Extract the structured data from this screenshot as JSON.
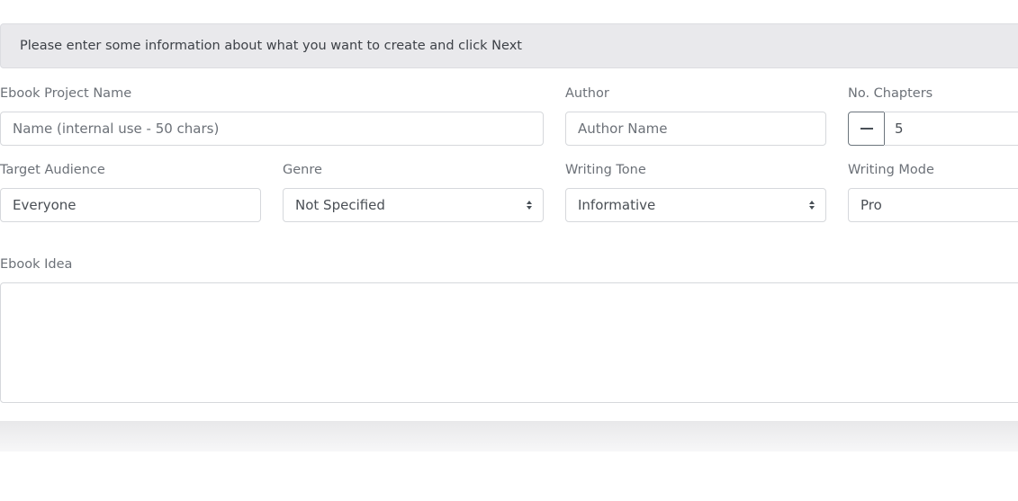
{
  "info": {
    "text": "Please enter some information about what you want to create and click Next"
  },
  "form": {
    "project_name": {
      "label": "Ebook Project Name",
      "placeholder": "Name (internal use - 50 chars)",
      "value": ""
    },
    "author": {
      "label": "Author",
      "placeholder": "Author Name",
      "value": ""
    },
    "chapters": {
      "label": "No. Chapters",
      "value": "5"
    },
    "target_audience": {
      "label": "Target Audience",
      "value": "Everyone"
    },
    "genre": {
      "label": "Genre",
      "value": "Not Specified"
    },
    "writing_tone": {
      "label": "Writing Tone",
      "value": "Informative"
    },
    "writing_mode": {
      "label": "Writing Mode",
      "value": "Pro"
    },
    "ebook_idea": {
      "label": "Ebook Idea",
      "value": ""
    }
  },
  "icons": {
    "stepper_decrement": "minus-icon",
    "select_caret": "sort-caret-icon"
  }
}
